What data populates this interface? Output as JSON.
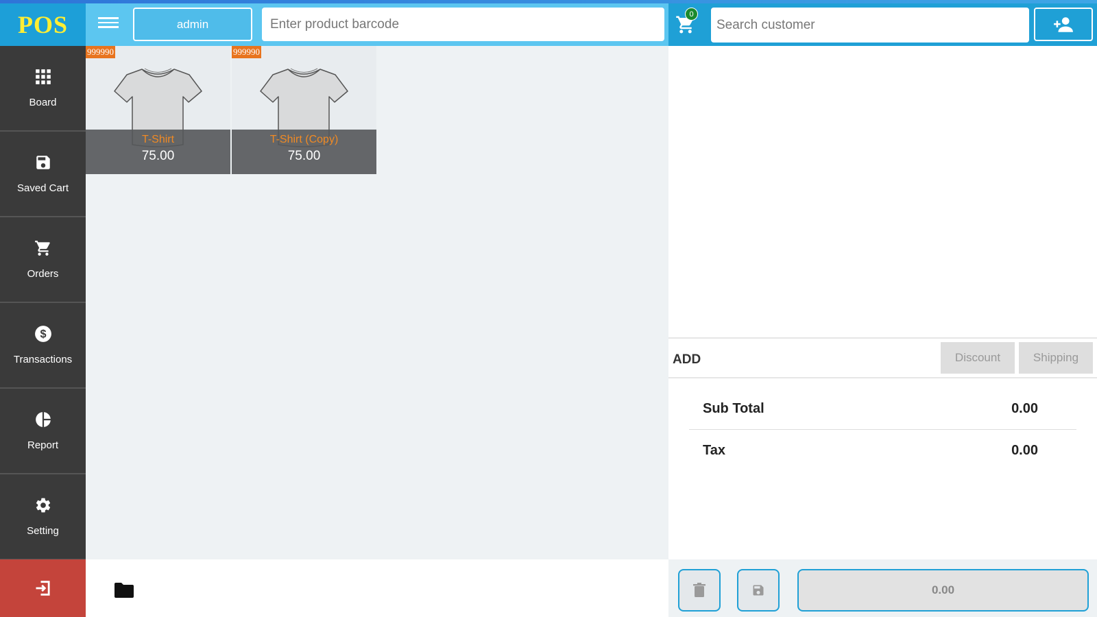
{
  "app": {
    "logo": "POS"
  },
  "sidebar": {
    "items": [
      {
        "label": "Board",
        "icon": "grid-icon"
      },
      {
        "label": "Saved Cart",
        "icon": "save-icon"
      },
      {
        "label": "Orders",
        "icon": "cart-icon"
      },
      {
        "label": "Transactions",
        "icon": "dollar-icon"
      },
      {
        "label": "Report",
        "icon": "pie-chart-icon"
      },
      {
        "label": "Setting",
        "icon": "gear-icon"
      }
    ],
    "logout_icon": "logout-icon"
  },
  "topbar": {
    "user_label": "admin",
    "barcode_placeholder": "Enter product barcode",
    "cart_count": "0",
    "customer_placeholder": "Search customer"
  },
  "products": [
    {
      "code": "999990",
      "name": "T-Shirt",
      "price": "75.00"
    },
    {
      "code": "999990",
      "name": "T-Shirt (Copy)",
      "price": "75.00"
    }
  ],
  "cart": {
    "add_label": "ADD",
    "discount_label": "Discount",
    "shipping_label": "Shipping",
    "subtotal_label": "Sub Total",
    "subtotal_value": "0.00",
    "tax_label": "Tax",
    "tax_value": "0.00",
    "pay_total": "0.00"
  },
  "colors": {
    "accent": "#1fa0d6",
    "topbar_light": "#5cc6f0",
    "sidebar": "#3a3a3a",
    "logout": "#c4443b",
    "logo_text": "#ffee33",
    "product_code": "#e8741e",
    "product_name": "#f08a24"
  }
}
